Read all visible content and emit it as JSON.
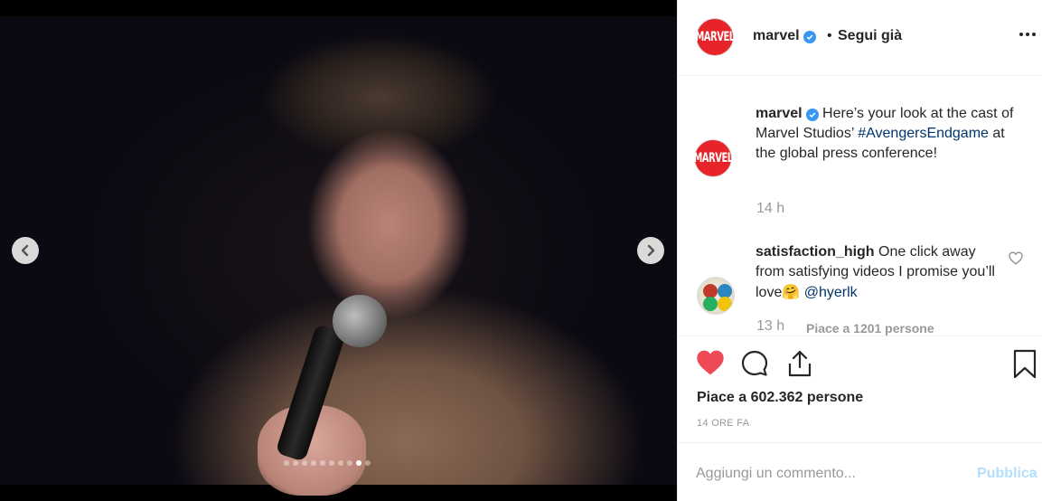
{
  "media": {
    "prev_icon": "chevron-left-icon",
    "next_icon": "chevron-right-icon",
    "carousel_total": 10,
    "carousel_active": 9
  },
  "header": {
    "avatar_text": "MARVEL",
    "username": "marvel",
    "separator": "•",
    "follow_status": "Segui già",
    "more_icon": "more-horizontal-icon"
  },
  "caption": {
    "avatar_text": "MARVEL",
    "username": "marvel",
    "text_before": "Here’s your look at the cast of Marvel Studios’",
    "hashtag": "#AvengersEndgame",
    "text_after": "at the global press conference!",
    "time": "14 h"
  },
  "comment": {
    "username": "satisfaction_high",
    "text": "One click away from satisfying videos I promise you’ll love",
    "emoji": "🤗",
    "mention": "@hyerlk",
    "time": "13 h",
    "likes": "Piace a 1201 persone"
  },
  "actions": {
    "like_icon": "heart-filled-icon",
    "comment_icon": "comment-bubble-icon",
    "share_icon": "share-upload-icon",
    "save_icon": "bookmark-icon",
    "like_color": "#ed4956"
  },
  "likes": {
    "prefix": "Piace a",
    "count": "602.362",
    "suffix": "persone"
  },
  "timestamp": "14 ORE FA",
  "add_comment": {
    "placeholder": "Aggiungi un commento...",
    "publish_label": "Pubblica"
  }
}
